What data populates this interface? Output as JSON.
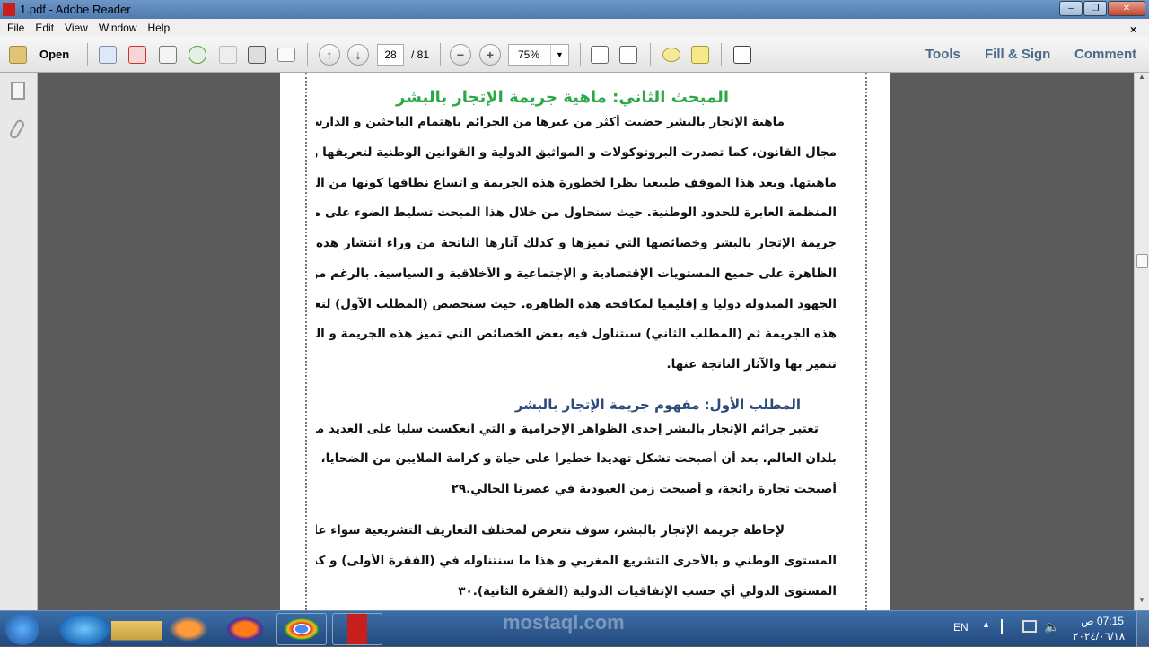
{
  "window": {
    "title": "1.pdf - Adobe Reader",
    "min": "–",
    "max": "❐",
    "close": "✕"
  },
  "menu": [
    "File",
    "Edit",
    "View",
    "Window",
    "Help"
  ],
  "menu_close": "×",
  "toolbar": {
    "open": "Open",
    "page": "28",
    "total": "/ 81",
    "zoom": "75%",
    "tools": "Tools",
    "fill_sign": "Fill & Sign",
    "comment": "Comment"
  },
  "document": {
    "heading": "المبحث الثاني: ماهية جريمة الإتجار بالبشر",
    "para1": [
      "ماهية الإتجار بالبشر حضيت أكثر من غيرها من الجرائم باهتمام الباحثين و الدارسين في",
      "مجال القانون، كما تصدرت البروتوكولات و المواثيق الدولية و القوانين الوطنية لتعريفها و تحديد",
      "ماهيتها. ويعد هذا الموقف طبيعيا نظرا لخطورة هذه الجريمة و اتساع نطاقها كونها من الجرائم",
      "المنظمة العابرة للحدود الوطنية. حيث سنحاول من خلال هذا المبحث تسليط الضوء على مفهوم",
      "جريمة الإتجار بالبشر وخصائصها التي تميزها و كذلك آثارها الناتجة من وراء انتشار هذه",
      "الظاهرة على جميع المستويات الإقتصادية و الإجتماعية و الأخلاقية و السياسية. بالرغم من",
      "الجهود المبذولة دوليا و إقليميا لمكافحة هذه الظاهرة. حيث سنخصص (المطلب الآول) لتعريف",
      "هذه الجريمة ثم (المطلب الثاني) سنتناول فيه بعض الخصائص التي تميز هذه الجريمة و التي",
      "تتميز بها والآثار الناتجة عنها."
    ],
    "subheading": "المطلب الأول: مفهوم جريمة الإتجار بالبشر",
    "para2": [
      "تعتبر جرائم الإتجار بالبشر إحدى الظواهر الإجرامية و التي انعكست سلبا على العديد من",
      "بلدان العالم. بعد أن أصبحت تشكل تهديدا خطيرا على حياة و كرامة الملايين من الضحايا، بحيث",
      "أصبحت تجارة رائجة، و أصبحت زمن العبودية في عصرنا الحالي.٢٩"
    ],
    "para3": [
      "لإحاطة جريمة الإتجار بالبشر، سوف نتعرض لمختلف التعاريف التشريعية سواء على",
      "المستوى الوطني و بالأحرى التشريع المغربي و هذا ما سنتناوله في (الفقرة الأولى) و كذلك على",
      "المستوى الدولي أي حسب الإتفاقيات الدولية (الفقرة الثانية).٣٠"
    ]
  },
  "watermark": "mostaql.com",
  "tray": {
    "lang": "EN",
    "time": "07:15 ص",
    "date": "٢٠٢٤/٠٦/١٨"
  }
}
